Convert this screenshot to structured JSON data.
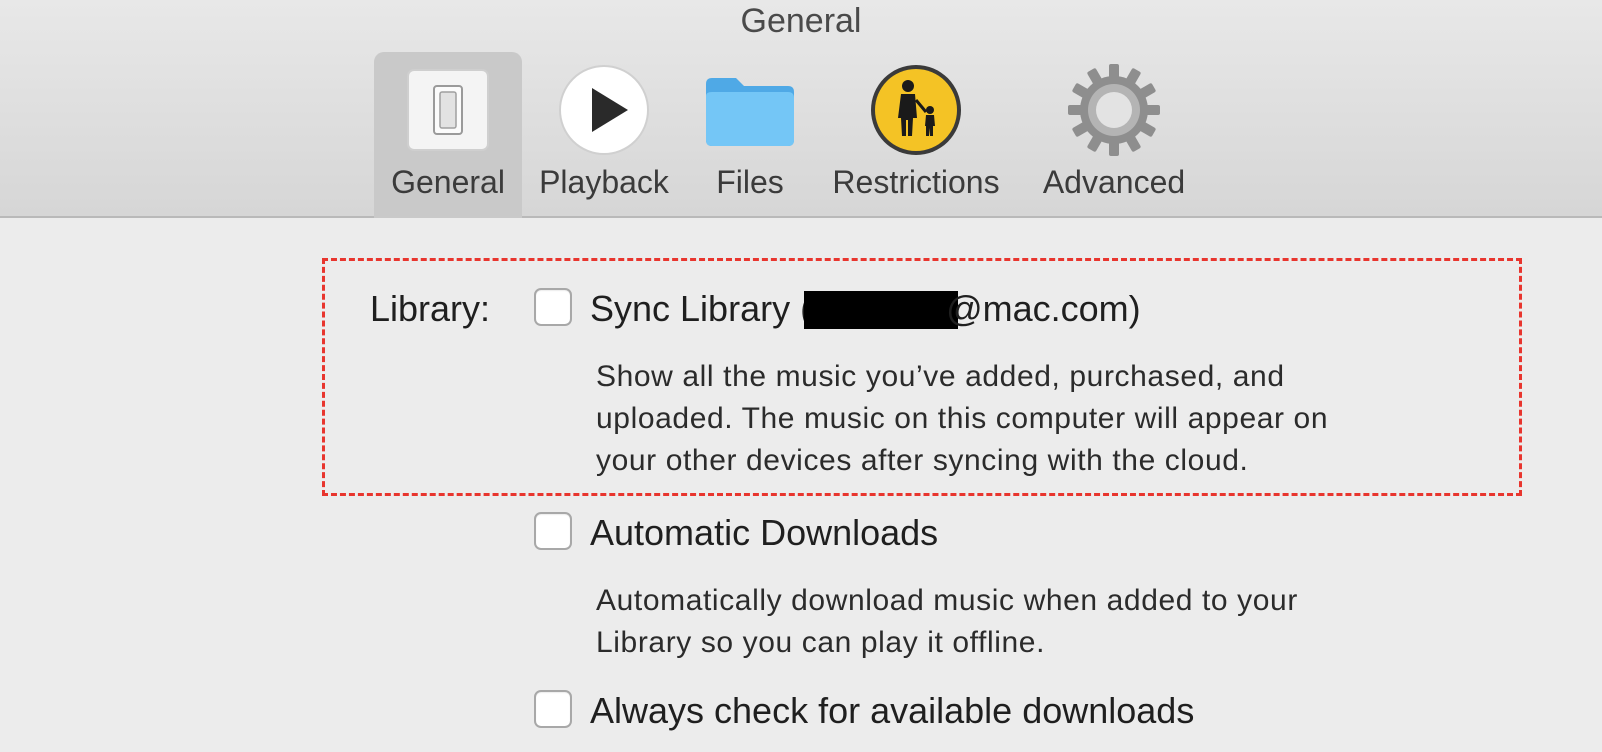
{
  "window": {
    "title": "General"
  },
  "tabs": [
    {
      "label": "General",
      "icon": "switch-icon",
      "selected": true
    },
    {
      "label": "Playback",
      "icon": "play-icon",
      "selected": false
    },
    {
      "label": "Files",
      "icon": "folder-icon",
      "selected": false
    },
    {
      "label": "Restrictions",
      "icon": "parental-restrictions-icon",
      "selected": false
    },
    {
      "label": "Advanced",
      "icon": "gear-icon",
      "selected": false
    }
  ],
  "library": {
    "label": "Library:",
    "sync": {
      "prefix": "Sync Library (",
      "suffix": "@mac.com)",
      "checked": false,
      "description": [
        "Show all the music you’ve added, purchased, and",
        "uploaded. The music on this computer will appear on",
        "your other devices after syncing with the cloud."
      ]
    },
    "automatic_downloads": {
      "label": "Automatic Downloads",
      "checked": false,
      "description": [
        "Automatically download music when added to your",
        "Library so you can play it offline."
      ]
    },
    "always_check": {
      "label": "Always check for available downloads",
      "checked": false
    }
  },
  "colors": {
    "highlight": "#e8352e",
    "restrictions_icon": "#f4c325",
    "folder_icon": "#5fb8f0"
  }
}
